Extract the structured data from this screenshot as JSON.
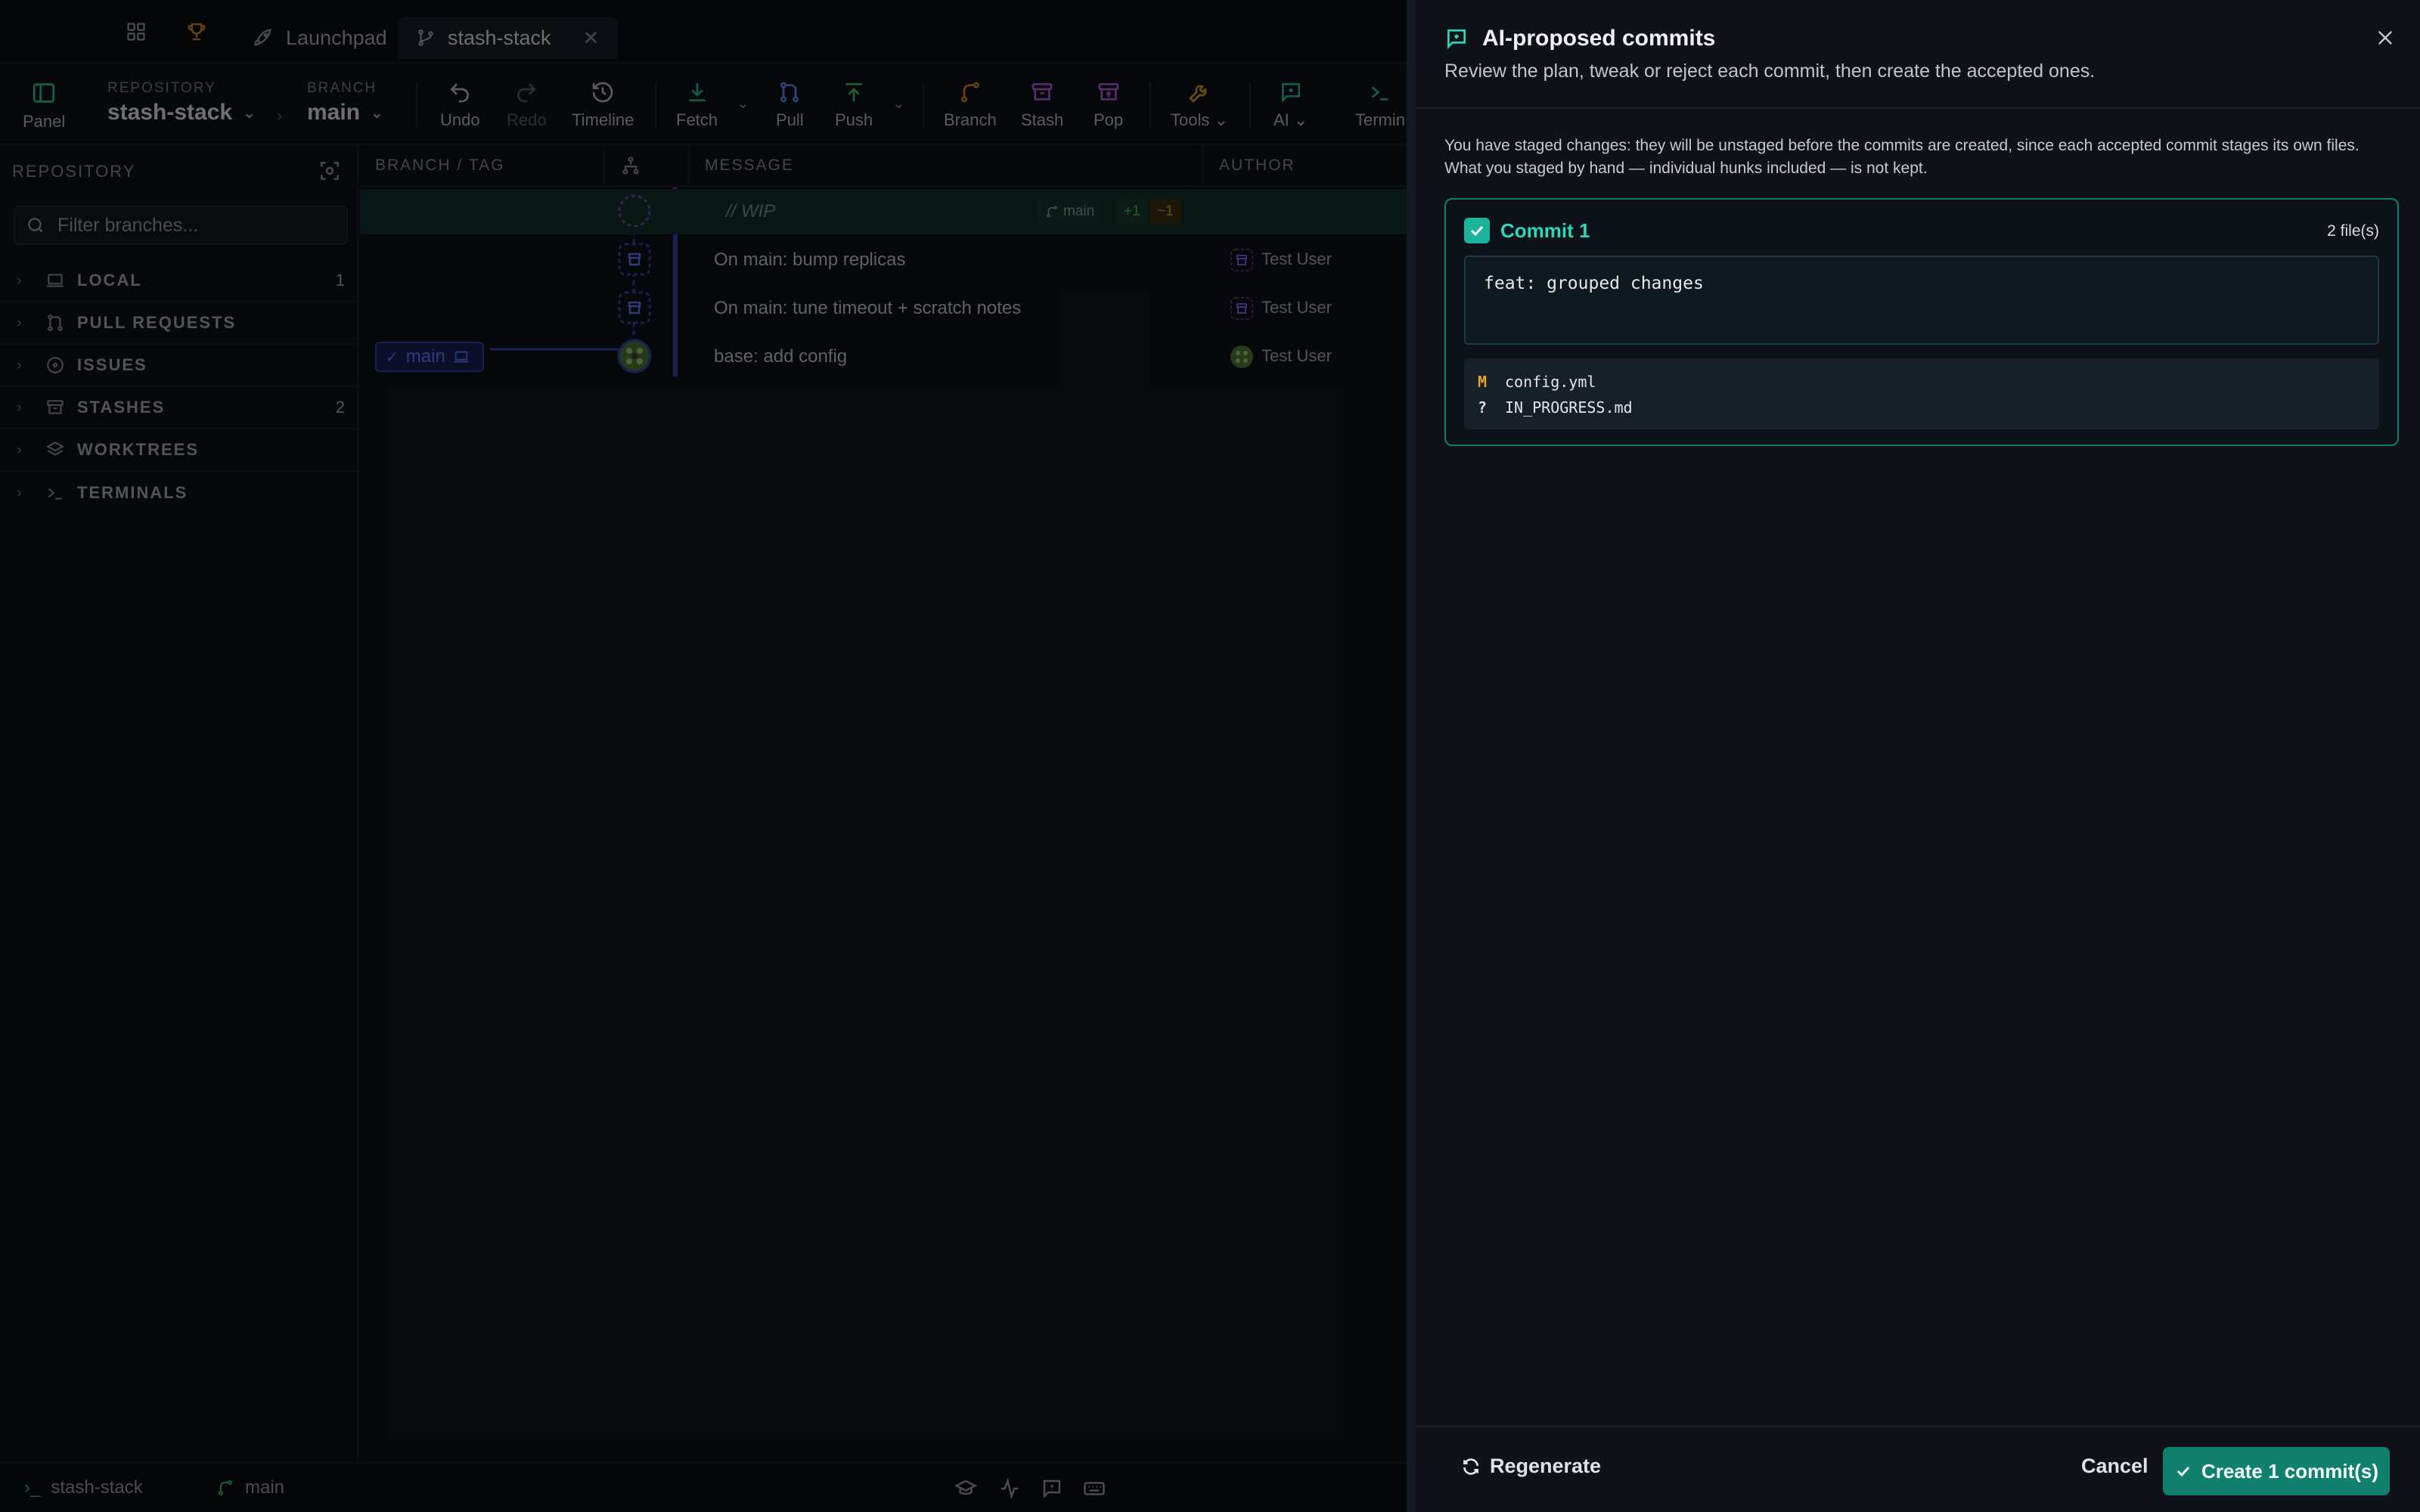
{
  "tabs": {
    "launchpad_label": "Launchpad",
    "repo_tab_label": "stash-stack"
  },
  "toolbar": {
    "panel_label": "Panel",
    "repository_caption": "REPOSITORY",
    "repository_name": "stash-stack",
    "branch_caption": "BRANCH",
    "branch_name": "main",
    "undo": "Undo",
    "redo": "Redo",
    "timeline": "Timeline",
    "fetch": "Fetch",
    "pull": "Pull",
    "push": "Push",
    "branch": "Branch",
    "stash": "Stash",
    "pop": "Pop",
    "tools": "Tools",
    "ai": "AI",
    "terminal": "Termin"
  },
  "sidebar": {
    "title": "REPOSITORY",
    "filter_placeholder": "Filter branches...",
    "sections": [
      {
        "name": "LOCAL",
        "count": "1",
        "icon": "laptop-icon"
      },
      {
        "name": "PULL REQUESTS",
        "count": "",
        "icon": "pull-request-icon"
      },
      {
        "name": "ISSUES",
        "count": "",
        "icon": "issue-icon"
      },
      {
        "name": "STASHES",
        "count": "2",
        "icon": "archive-icon"
      },
      {
        "name": "WORKTREES",
        "count": "",
        "icon": "layers-icon"
      },
      {
        "name": "TERMINALS",
        "count": "",
        "icon": "terminal-icon"
      }
    ]
  },
  "graph": {
    "headers": {
      "branch_tag": "BRANCH / TAG",
      "message": "MESSAGE",
      "author": "AUTHOR"
    },
    "wip": {
      "label": "// WIP",
      "branch": "main",
      "added": "+1",
      "modified": "~1"
    },
    "rows": [
      {
        "message": "On main: bump replicas",
        "author": "Test User"
      },
      {
        "message": "On main: tune timeout + scratch notes",
        "author": "Test User"
      },
      {
        "message": "base: add config",
        "author": "Test User",
        "ref": "main"
      }
    ]
  },
  "statusbar": {
    "repo": "stash-stack",
    "branch": "main"
  },
  "drawer": {
    "title": "AI-proposed commits",
    "subtitle": "Review the plan, tweak or reject each commit, then create the accepted ones.",
    "notice_line1": "You have staged changes: they will be unstaged before the commits are created, since each accepted commit stages its own files.",
    "notice_line2": "What you staged by hand — individual hunks included — is not kept.",
    "commit": {
      "title": "Commit 1",
      "file_count": "2 file(s)",
      "message": "feat: grouped changes",
      "files": [
        {
          "status": "M",
          "path": "config.yml"
        },
        {
          "status": "?",
          "path": "IN_PROGRESS.md"
        }
      ]
    },
    "footer": {
      "regenerate": "Regenerate",
      "cancel": "Cancel",
      "create": "Create 1 commit(s)"
    }
  },
  "colors": {
    "accent": "#11806f",
    "accent_text": "#2fd6ba",
    "wip_row": "#13322c",
    "ref_blue": "#5f7cff",
    "stash_purple": "#8a5cff",
    "status_modified": "#e5a52c"
  }
}
